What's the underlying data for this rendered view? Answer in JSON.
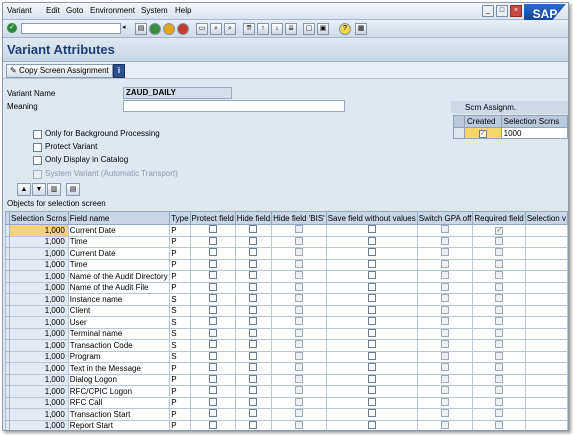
{
  "menu": [
    "Variant",
    "Edit",
    "Goto",
    "Environment",
    "System",
    "Help"
  ],
  "logo": "SAP",
  "title": "Variant Attributes",
  "app_toolbar": {
    "copy_label": "Copy Screen Assignment",
    "info_label": "i"
  },
  "form": {
    "variant_name_label": "Variant Name",
    "variant_name_value": "ZAUD_DAILY",
    "meaning_label": "Meaning",
    "meaning_value": ""
  },
  "options": [
    {
      "label": "Only for Background Processing",
      "disabled": false
    },
    {
      "label": "Protect Variant",
      "disabled": false
    },
    {
      "label": "Only Display in Catalog",
      "disabled": false
    },
    {
      "label": "System Variant (Automatic Transport)",
      "disabled": true
    }
  ],
  "scrn_assign": {
    "title": "Scrn Assignm.",
    "headers": [
      "Created",
      "Selection Scrns"
    ],
    "row": {
      "created": true,
      "screen": "1000"
    }
  },
  "grid": {
    "caption": "Objects for selection screen",
    "headers": [
      "Selection Scrns",
      "Field name",
      "Type",
      "Protect field",
      "Hide field",
      "Hide field 'BIS'",
      "Save field without values",
      "Switch GPA off",
      "Required field",
      "Selection v"
    ],
    "rows": [
      {
        "screen": "1,000",
        "field": "Current Date",
        "type": "P"
      },
      {
        "screen": "1,000",
        "field": "Time",
        "type": "P"
      },
      {
        "screen": "1,000",
        "field": "Current Date",
        "type": "P"
      },
      {
        "screen": "1,000",
        "field": "Time",
        "type": "P"
      },
      {
        "screen": "1,000",
        "field": "Name of the Audit Directory",
        "type": "P"
      },
      {
        "screen": "1,000",
        "field": "Name of the Audit File",
        "type": "P"
      },
      {
        "screen": "1,000",
        "field": "Instance name",
        "type": "S"
      },
      {
        "screen": "1,000",
        "field": "Client",
        "type": "S"
      },
      {
        "screen": "1,000",
        "field": "User",
        "type": "S"
      },
      {
        "screen": "1,000",
        "field": "Terminal name",
        "type": "S"
      },
      {
        "screen": "1,000",
        "field": "Transaction Code",
        "type": "S"
      },
      {
        "screen": "1,000",
        "field": "Program",
        "type": "S"
      },
      {
        "screen": "1,000",
        "field": "Text in the Message",
        "type": "P"
      },
      {
        "screen": "1,000",
        "field": "Dialog Logon",
        "type": "P"
      },
      {
        "screen": "1,000",
        "field": "RFC/CPIC Logon",
        "type": "P"
      },
      {
        "screen": "1,000",
        "field": "RFC Call",
        "type": "P"
      },
      {
        "screen": "1,000",
        "field": "Transaction Start",
        "type": "P"
      },
      {
        "screen": "1,000",
        "field": "Report Start",
        "type": "P"
      }
    ]
  }
}
